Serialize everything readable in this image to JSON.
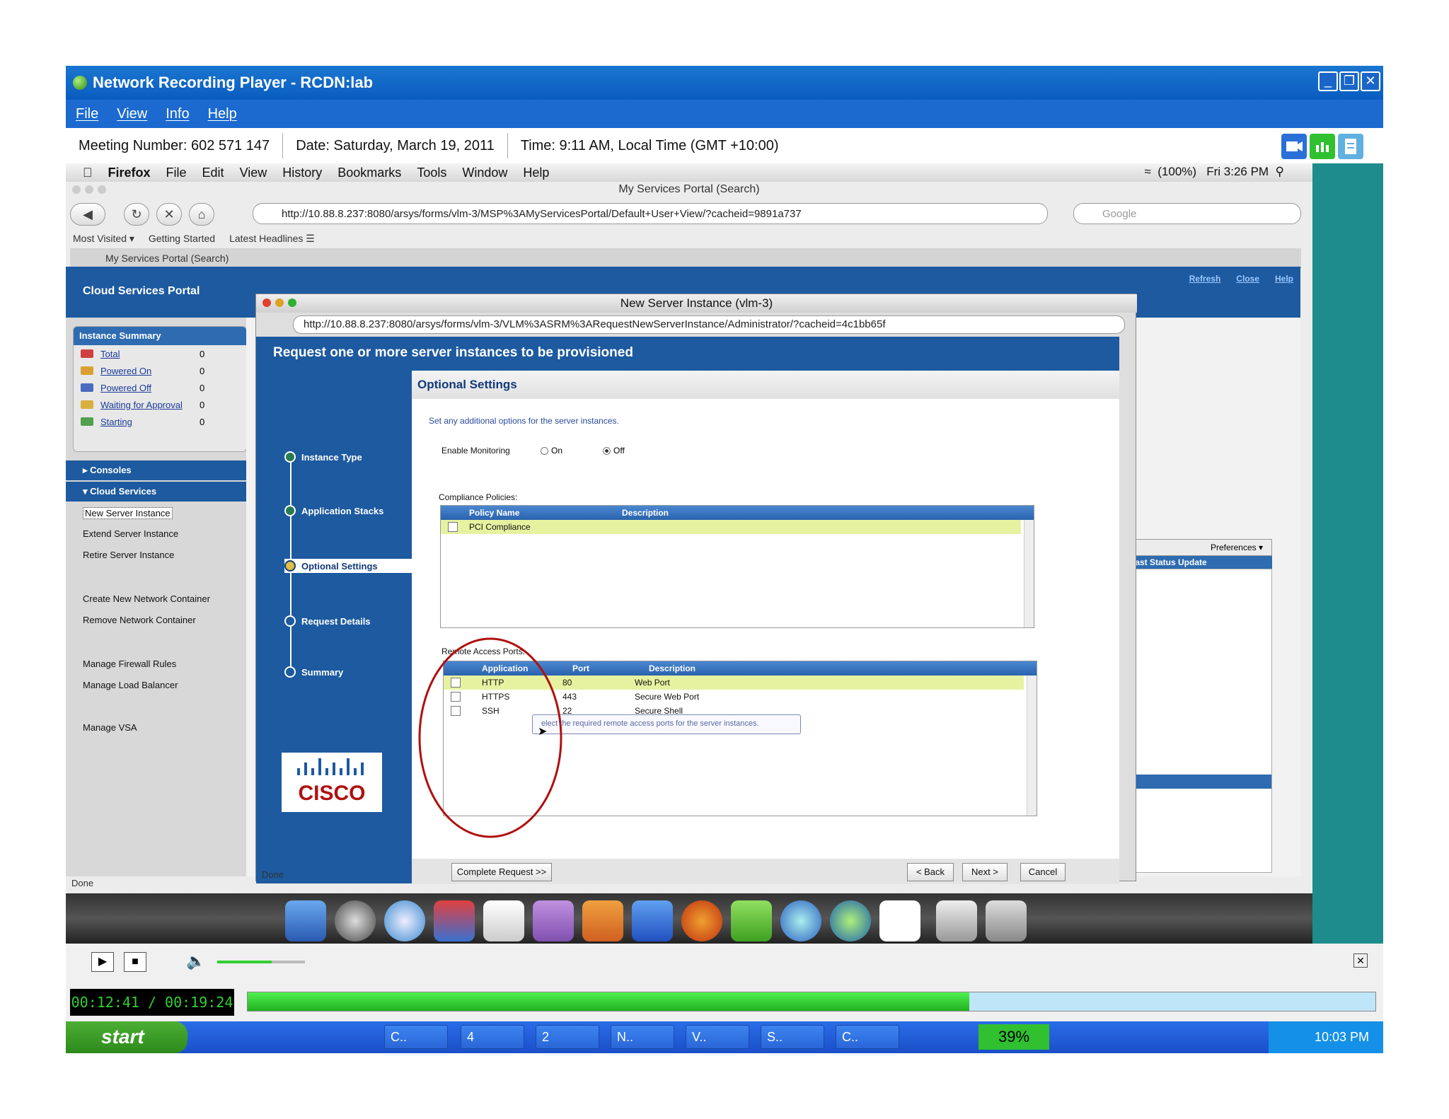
{
  "window": {
    "title": "Network Recording Player - RCDN:lab",
    "minimize": "_",
    "restore": "❐",
    "close": "✕"
  },
  "menu": [
    "File",
    "View",
    "Info",
    "Help"
  ],
  "info": {
    "meeting": "Meeting Number: 602 571 147",
    "date": "Date: Saturday, March 19, 2011",
    "time": "Time: 9:11 AM, Local Time (GMT +10:00)"
  },
  "mac_menu": {
    "app": "Firefox",
    "items": [
      "File",
      "Edit",
      "View",
      "History",
      "Bookmarks",
      "Tools",
      "Window",
      "Help"
    ],
    "battery": "(100%)",
    "clock": "Fri 3:26 PM"
  },
  "firefox": {
    "window_title": "My Services Portal (Search)",
    "url": "http://10.88.8.237:8080/arsys/forms/vlm-3/MSP%3AMyServicesPortal/Default+User+View/?cacheid=9891a737",
    "search_placeholder": "Google",
    "bookmarks": [
      "Most Visited ▾",
      "Getting Started",
      "Latest Headlines ☰"
    ],
    "tab": "My Services Portal (Search)",
    "status": "Done"
  },
  "portal": {
    "header": "Cloud Services Portal",
    "top_links": [
      "Refresh",
      "Close",
      "Help"
    ],
    "instance_summary": {
      "title": "Instance Summary",
      "rows": [
        {
          "label": "Total",
          "count": "0",
          "color": "#d04040"
        },
        {
          "label": "Powered On",
          "count": "0",
          "color": "#d8a030"
        },
        {
          "label": "Powered Off",
          "count": "0",
          "color": "#4a6ac0"
        },
        {
          "label": "Waiting for Approval",
          "count": "0",
          "color": "#d8b040"
        },
        {
          "label": "Starting",
          "count": "0",
          "color": "#50a050"
        }
      ]
    },
    "sections": {
      "consoles": "Consoles",
      "cloud_services": "Cloud Services"
    },
    "links": [
      "New Server Instance",
      "Extend Server Instance",
      "Retire Server Instance",
      "Create New Network Container",
      "Remove Network Container",
      "Manage Firewall Rules",
      "Manage Load Balancer",
      "Manage VSA"
    ],
    "preferences": "Preferences ▾",
    "last_status": "Last Status Update"
  },
  "dialog": {
    "title": "New Server Instance (vlm-3)",
    "url": "http://10.88.8.237:8080/arsys/forms/vlm-3/VLM%3ASRM%3ARequestNewServerInstance/Administrator/?cacheid=4c1bb65f",
    "header": "Request one or more server instances to be provisioned",
    "steps": [
      "Instance Type",
      "Application Stacks",
      "Optional Settings",
      "Request Details",
      "Summary"
    ],
    "section_title": "Optional Settings",
    "intro": "Set any additional options for the server instances.",
    "monitoring_label": "Enable Monitoring",
    "monitoring_on": "On",
    "monitoring_off": "Off",
    "compliance_label": "Compliance Policies:",
    "compliance_headers": [
      "Policy Name",
      "Description"
    ],
    "compliance_rows": [
      {
        "name": "PCI Compliance",
        "desc": ""
      }
    ],
    "ports_label": "Remote Access Ports:",
    "ports_headers": [
      "Application",
      "Port",
      "Description"
    ],
    "ports_rows": [
      {
        "app": "HTTP",
        "port": "80",
        "desc": "Web Port"
      },
      {
        "app": "HTTPS",
        "port": "443",
        "desc": "Secure Web Port"
      },
      {
        "app": "SSH",
        "port": "22",
        "desc": "Secure Shell"
      }
    ],
    "tooltip": "elect the required remote access ports for the server instances.",
    "buttons": {
      "complete": "Complete Request >>",
      "back": "< Back",
      "next": "Next >",
      "cancel": "Cancel"
    },
    "status": "Done",
    "logo": "CISCO"
  },
  "player": {
    "elapsed": "00:12:41 / 00:19:24",
    "progress": 0.64,
    "volume": 0.62
  },
  "taskbar": {
    "start": "start",
    "tasks": [
      "C..",
      "4",
      "2",
      "N..",
      "V..",
      "S..",
      "C.."
    ],
    "percent": "39%",
    "clock": "10:03 PM"
  },
  "colors": {
    "xp_blue": "#1a6ad0",
    "portal_blue": "#1d5aa0",
    "teal": "#1e8c8c",
    "annotation": "#b01010",
    "progress_green": "#30d030"
  }
}
